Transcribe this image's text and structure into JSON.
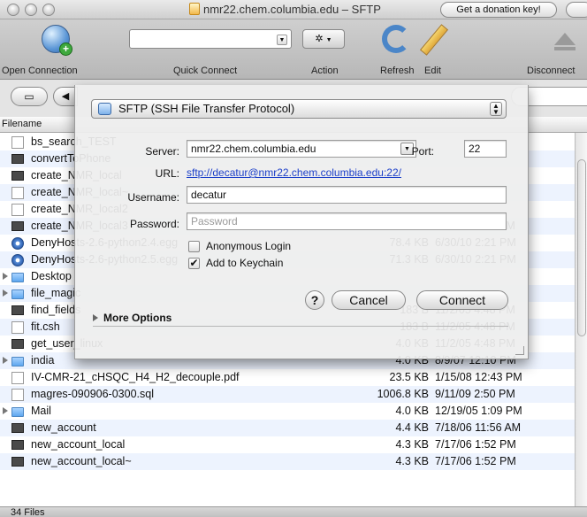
{
  "window": {
    "title": "nmr22.chem.columbia.edu – SFTP",
    "donation_label": "Get a donation key!"
  },
  "toolbar": {
    "open_connection": "Open Connection",
    "quick_connect": "Quick Connect",
    "action": "Action",
    "refresh": "Refresh",
    "edit": "Edit",
    "disconnect": "Disconnect"
  },
  "list": {
    "header_filename": "Filename",
    "files": [
      {
        "name": "bs_search_TEST",
        "size": "",
        "date": "",
        "type": "doc"
      },
      {
        "name": "convertToPhone",
        "size": "",
        "date": "",
        "type": "exec"
      },
      {
        "name": "create_NMR_local",
        "size": "",
        "date": "",
        "type": "exec"
      },
      {
        "name": "create_NMR_local~",
        "size": "",
        "date": "",
        "type": "doc"
      },
      {
        "name": "create_NMR_local2",
        "size": "",
        "date": "",
        "type": "doc"
      },
      {
        "name": "create_NMR_local3",
        "size": "4.3 KB",
        "date": "11/6/07 4:36 PM",
        "type": "exec"
      },
      {
        "name": "DenyHosts-2.6-python2.4.egg",
        "size": "78.4 KB",
        "date": "6/30/10 2:21 PM",
        "type": "pkg"
      },
      {
        "name": "DenyHosts-2.6-python2.5.egg",
        "size": "71.3 KB",
        "date": "6/30/10 2:21 PM",
        "type": "pkg"
      },
      {
        "name": "Desktop",
        "size": "",
        "date": "",
        "type": "folder"
      },
      {
        "name": "file_magic",
        "size": "",
        "date": "",
        "type": "folder"
      },
      {
        "name": "find_fields",
        "size": "183 B",
        "date": "11/2/05 4:48 PM",
        "type": "exec"
      },
      {
        "name": "fit.csh",
        "size": "183 B",
        "date": "11/2/05 4:48 PM",
        "type": "doc"
      },
      {
        "name": "get_user_linux",
        "size": "4.0 KB",
        "date": "11/2/05 4:48 PM",
        "type": "exec"
      },
      {
        "name": "india",
        "size": "4.0 KB",
        "date": "8/9/07 12:10 PM",
        "type": "folder"
      },
      {
        "name": "IV-CMR-21_cHSQC_H4_H2_decouple.pdf",
        "size": "23.5 KB",
        "date": "1/15/08 12:43 PM",
        "type": "pdf"
      },
      {
        "name": "magres-090906-0300.sql",
        "size": "1006.8 KB",
        "date": "9/11/09 2:50 PM",
        "type": "doc"
      },
      {
        "name": "Mail",
        "size": "4.0 KB",
        "date": "12/19/05 1:09 PM",
        "type": "folder"
      },
      {
        "name": "new_account",
        "size": "4.4 KB",
        "date": "7/18/06 11:56 AM",
        "type": "exec"
      },
      {
        "name": "new_account_local",
        "size": "4.3 KB",
        "date": "7/17/06 1:52 PM",
        "type": "exec"
      },
      {
        "name": "new_account_local~",
        "size": "4.3 KB",
        "date": "7/17/06 1:52 PM",
        "type": "exec"
      }
    ]
  },
  "status": {
    "file_count": "34 Files"
  },
  "sheet": {
    "protocol": "SFTP (SSH File Transfer Protocol)",
    "server_label": "Server:",
    "server_value": "nmr22.chem.columbia.edu",
    "port_label": "Port:",
    "port_value": "22",
    "url_label": "URL:",
    "url_value": "sftp://decatur@nmr22.chem.columbia.edu:22/",
    "username_label": "Username:",
    "username_value": "decatur",
    "password_label": "Password:",
    "password_placeholder": "Password",
    "anonymous_label": "Anonymous Login",
    "keychain_label": "Add to Keychain",
    "anonymous_checked": false,
    "keychain_checked": true,
    "help_label": "?",
    "cancel_label": "Cancel",
    "connect_label": "Connect",
    "more_options_label": "More Options"
  },
  "icons": {
    "globe": "globe-icon",
    "refresh": "refresh-icon",
    "edit": "pencil-icon",
    "disconnect": "eject-icon",
    "lock": "lock-icon",
    "folder": "folder-icon",
    "document": "document-icon",
    "executable": "terminal-icon",
    "egg": "package-icon"
  }
}
